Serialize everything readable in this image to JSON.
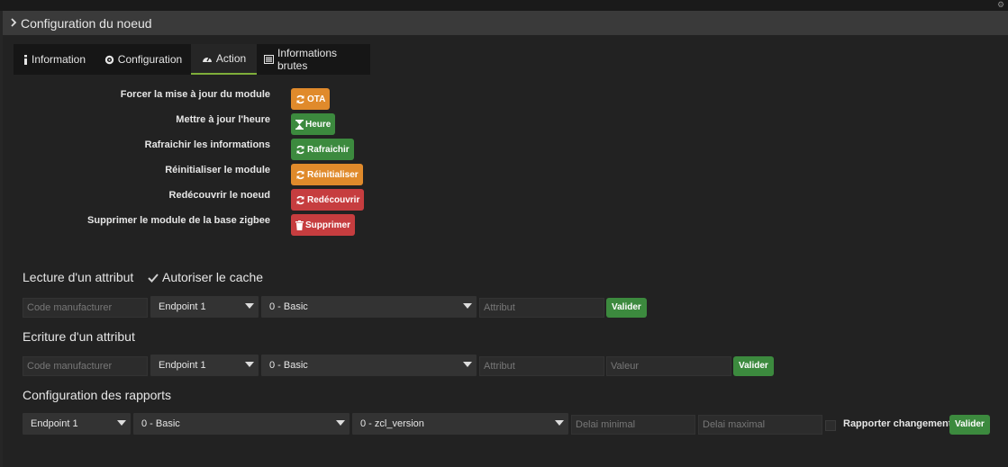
{
  "window": {
    "title": "Configuration du noeud"
  },
  "tabs": [
    {
      "label": "Information",
      "icon": "info-icon"
    },
    {
      "label": "Configuration",
      "icon": "gear-icon"
    },
    {
      "label": "Action",
      "icon": "dashboard-icon",
      "active": true
    },
    {
      "label": "Informations brutes",
      "icon": "list-icon"
    }
  ],
  "actions": [
    {
      "label": "Forcer la mise à jour du module",
      "button": "OTA",
      "color": "orange",
      "icon": "refresh-icon"
    },
    {
      "label": "Mettre à jour l'heure",
      "button": "Heure",
      "color": "green",
      "icon": "hourglass-icon"
    },
    {
      "label": "Rafraichir les informations",
      "button": "Rafraichir",
      "color": "green",
      "icon": "refresh-icon"
    },
    {
      "label": "Réinitialiser le module",
      "button": "Réinitialiser",
      "color": "orange",
      "icon": "refresh-icon"
    },
    {
      "label": "Redécouvrir le noeud",
      "button": "Redécouvrir",
      "color": "red",
      "icon": "refresh-icon"
    },
    {
      "label": "Supprimer le module de la base zigbee",
      "button": "Supprimer",
      "color": "red",
      "icon": "trash-icon"
    }
  ],
  "read_attr": {
    "title": "Lecture d'un attribut",
    "cache_label": "Autoriser le cache",
    "cache_checked": true,
    "manufacturer_placeholder": "Code manufacturer",
    "endpoint": "Endpoint 1",
    "cluster": "0 - Basic",
    "attribute_placeholder": "Attribut",
    "submit": "Valider"
  },
  "write_attr": {
    "title": "Ecriture d'un attribut",
    "manufacturer_placeholder": "Code manufacturer",
    "endpoint": "Endpoint 1",
    "cluster": "0 - Basic",
    "attribute_placeholder": "Attribut",
    "value_placeholder": "Valeur",
    "submit": "Valider"
  },
  "report_config": {
    "title": "Configuration des rapports",
    "endpoint": "Endpoint 1",
    "cluster": "0 - Basic",
    "attribute": "0 - zcl_version",
    "min_delay_placeholder": "Delai minimal",
    "max_delay_placeholder": "Delai maximal",
    "report_change_label": "Rapporter changement",
    "submit": "Valider"
  },
  "colors": {
    "orange": "#e08a2b",
    "green": "#3c8a3e",
    "red": "#c63d3f",
    "active_tab_underline": "#7fae3a"
  }
}
